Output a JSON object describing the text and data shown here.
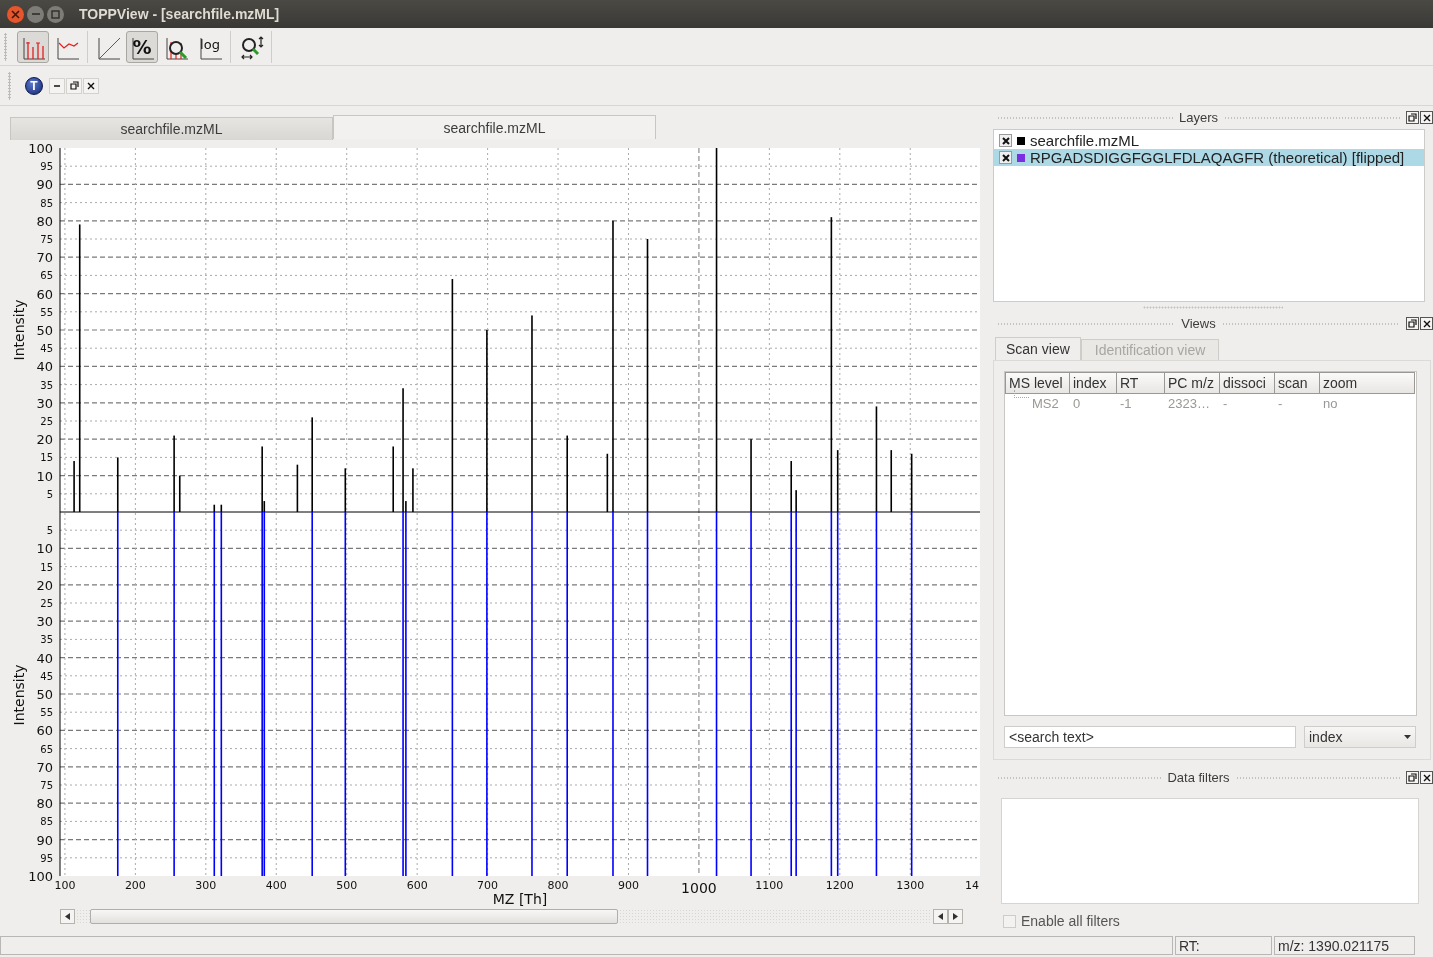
{
  "window": {
    "title": "TOPPView - [searchfile.mzML]"
  },
  "toolbar_groups": [
    [
      {
        "kind": "sticks",
        "on": true
      },
      {
        "kind": "lines",
        "on": false
      }
    ],
    [
      {
        "kind": "linear",
        "on": false
      },
      {
        "kind": "percent",
        "label": "%",
        "on": true
      },
      {
        "kind": "zoom",
        "on": false
      },
      {
        "kind": "log",
        "label": "log",
        "on": false
      }
    ],
    [
      {
        "kind": "fit",
        "on": false
      }
    ]
  ],
  "mdi_bar": {
    "icon_letter": "T"
  },
  "tabs": [
    {
      "label": "searchfile.mzML",
      "selected": false
    },
    {
      "label": "searchfile.mzML",
      "selected": true
    }
  ],
  "plot": {
    "lower_ylabel": "Intensity",
    "edge_tick_label": "14",
    "chart_data": {
      "type": "bar",
      "xlabel": "MZ [Th]",
      "ylabel": "Intensity",
      "x": [
        113,
        121,
        175,
        255,
        263,
        312,
        322,
        380,
        383,
        430,
        451,
        498,
        566,
        580,
        584,
        594,
        650,
        699,
        763,
        813,
        870,
        878,
        927,
        1025,
        1074,
        1131,
        1138,
        1188,
        1197,
        1252,
        1273,
        1302
      ],
      "grid": true,
      "series": [
        {
          "color": "#000000",
          "values": [
            14,
            79,
            15,
            21,
            10,
            2,
            2,
            18,
            3,
            13,
            26,
            12,
            18,
            34,
            3,
            12,
            64,
            50,
            54,
            21,
            16,
            80,
            75,
            100,
            20,
            14,
            6,
            81,
            17,
            29,
            17,
            16
          ]
        },
        {
          "color": "#0000ff",
          "values": [
            null,
            null,
            -100,
            -100,
            null,
            -100,
            -100,
            -100,
            -100,
            null,
            -100,
            -100,
            null,
            -100,
            -100,
            null,
            -100,
            -100,
            -100,
            -100,
            null,
            -100,
            -100,
            -100,
            -100,
            -100,
            -100,
            -100,
            -100,
            -100,
            null,
            -100
          ]
        }
      ],
      "xlim": [
        93,
        1399
      ],
      "ylim": [
        -100,
        100
      ],
      "xticks": [
        100,
        200,
        300,
        400,
        500,
        600,
        700,
        800,
        900,
        1000,
        1100,
        1200,
        1300
      ],
      "yticks": [
        {
          "value": 100,
          "label": "100"
        },
        {
          "value": 95,
          "label": "95"
        },
        {
          "value": 90,
          "label": "90"
        },
        {
          "value": 85,
          "label": "85"
        },
        {
          "value": 80,
          "label": "80"
        },
        {
          "value": 75,
          "label": "75"
        },
        {
          "value": 70,
          "label": "70"
        },
        {
          "value": 65,
          "label": "65"
        },
        {
          "value": 60,
          "label": "60"
        },
        {
          "value": 55,
          "label": "55"
        },
        {
          "value": 50,
          "label": "50"
        },
        {
          "value": 45,
          "label": "45"
        },
        {
          "value": 40,
          "label": "40"
        },
        {
          "value": 35,
          "label": "35"
        },
        {
          "value": 30,
          "label": "30"
        },
        {
          "value": 25,
          "label": "25"
        },
        {
          "value": 20,
          "label": "20"
        },
        {
          "value": 15,
          "label": "15"
        },
        {
          "value": 10,
          "label": "10"
        },
        {
          "value": 5,
          "label": "5"
        },
        {
          "value": -5,
          "label": "5"
        },
        {
          "value": -10,
          "label": "10"
        },
        {
          "value": -15,
          "label": "15"
        },
        {
          "value": -20,
          "label": "20"
        },
        {
          "value": -25,
          "label": "25"
        },
        {
          "value": -30,
          "label": "30"
        },
        {
          "value": -35,
          "label": "35"
        },
        {
          "value": -40,
          "label": "40"
        },
        {
          "value": -45,
          "label": "45"
        },
        {
          "value": -50,
          "label": "50"
        },
        {
          "value": -55,
          "label": "55"
        },
        {
          "value": -60,
          "label": "60"
        },
        {
          "value": -65,
          "label": "65"
        },
        {
          "value": -70,
          "label": "70"
        },
        {
          "value": -75,
          "label": "75"
        },
        {
          "value": -80,
          "label": "80"
        },
        {
          "value": -85,
          "label": "85"
        },
        {
          "value": -90,
          "label": "90"
        },
        {
          "value": -95,
          "label": "95"
        },
        {
          "value": -100,
          "label": "100"
        }
      ]
    }
  },
  "layers": {
    "title": "Layers",
    "items": [
      {
        "name": "searchfile.mzML",
        "checked": true,
        "color": "#000000",
        "selected": false
      },
      {
        "name": "RPGADSDIGGFGGLFDLAQAGFR (theoretical) [flipped]",
        "checked": true,
        "color": "#7b2fe0",
        "selected": true
      }
    ]
  },
  "views": {
    "title": "Views",
    "tabs": [
      {
        "label": "Scan view",
        "selected": true
      },
      {
        "label": "Identification view",
        "selected": false
      }
    ],
    "table": {
      "columns": [
        "MS level",
        "index",
        "RT",
        "PC m/z",
        "dissoci",
        "scan",
        "zoom"
      ],
      "rows": [
        [
          "MS2",
          "0",
          "-1",
          "2323…",
          "-",
          "-",
          "no"
        ]
      ]
    },
    "search": {
      "value": "<search text>"
    },
    "search_column": {
      "value": "index"
    }
  },
  "data_filters": {
    "title": "Data filters",
    "enable_all": {
      "label": "Enable all filters",
      "checked": false,
      "disabled": true
    }
  },
  "status_bar": {
    "rt": "RT:",
    "mz": "m/z: 1390.021175"
  }
}
